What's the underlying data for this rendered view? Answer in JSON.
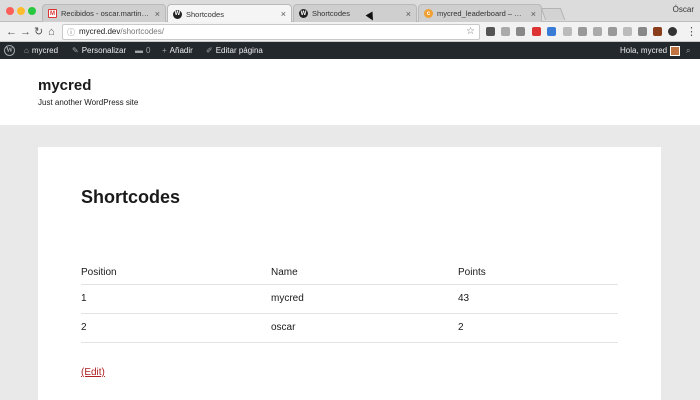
{
  "browser": {
    "tabs": [
      {
        "label": "Recibidos - oscar.martin@gn",
        "favicon": "gmail-icon",
        "active": false
      },
      {
        "label": "Shortcodes",
        "favicon": "wordpress-icon",
        "active": true
      },
      {
        "label": "Shortcodes",
        "favicon": "wordpress-icon",
        "active": false
      },
      {
        "label": "mycred_leaderboard – myCRE",
        "favicon": "mycred-icon",
        "active": false
      }
    ],
    "tab_close": "×",
    "profile_name": "Óscar",
    "url_host": "mycred.dev",
    "url_path": "/shortcodes/"
  },
  "adminbar": {
    "site_name": "mycred",
    "customize": "Personalizar",
    "comments_count": "0",
    "add_new": "Añadir",
    "edit_page": "Editar página",
    "greeting": "Hola, mycred"
  },
  "site": {
    "title": "mycred",
    "tagline": "Just another WordPress site"
  },
  "page": {
    "title": "Shortcodes",
    "table": {
      "headers": [
        "Position",
        "Name",
        "Points"
      ],
      "rows": [
        [
          "1",
          "mycred",
          "43"
        ],
        [
          "2",
          "oscar",
          "2"
        ]
      ]
    },
    "edit_link": "(Edit)"
  },
  "colors": {
    "adminbar_bg": "#23282d",
    "edit_link": "#b02020",
    "page_bg": "#e9e9e9"
  }
}
